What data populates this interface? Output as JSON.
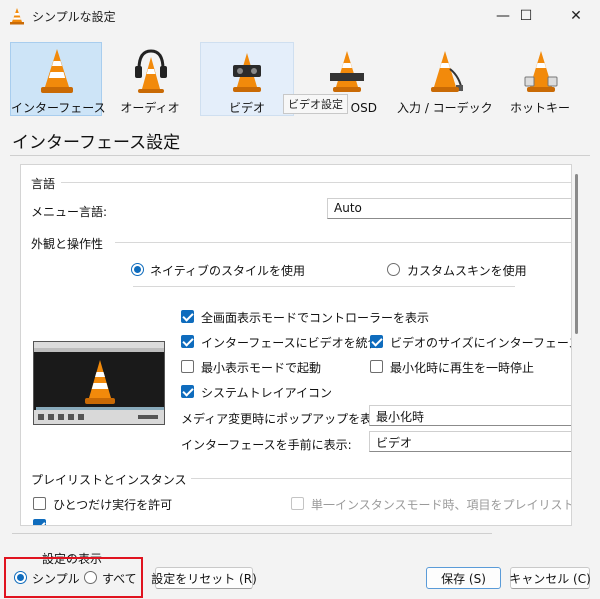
{
  "window": {
    "title": "シンプルな設定",
    "controls": {
      "minimize": "—",
      "maximize": "☐",
      "close": "✕"
    }
  },
  "categories": [
    {
      "label": "インターフェース",
      "icon": "vlc-cone-icon",
      "state": "selected"
    },
    {
      "label": "オーディオ",
      "icon": "headphones-icon",
      "state": "normal"
    },
    {
      "label": "ビデオ",
      "icon": "video-cone-icon",
      "state": "hover"
    },
    {
      "label": "字幕 / OSD",
      "icon": "subtitle-cone-icon",
      "state": "normal"
    },
    {
      "label": "入力 / コーデック",
      "icon": "codec-cone-icon",
      "state": "normal"
    },
    {
      "label": "ホットキー",
      "icon": "hotkey-cone-icon",
      "state": "normal"
    }
  ],
  "tooltip": "ビデオ設定",
  "section_title": "インターフェース設定",
  "language": {
    "group_title": "言語",
    "menu_language_label": "メニュー言語:",
    "menu_language_value": "Auto"
  },
  "look_feel": {
    "group_title": "外観と操作性",
    "native_style_label": "ネイティブのスタイルを使用",
    "native_style_selected": true,
    "custom_skin_label": "カスタムスキンを使用",
    "custom_skin_selected": false,
    "options": {
      "fullscreen_controller": {
        "label": "全画面表示モードでコントローラーを表示",
        "checked": true
      },
      "embed_video": {
        "label": "インターフェースにビデオを統合",
        "checked": true
      },
      "resize_to_video": {
        "label": "ビデオのサイズにインターフェースをリサイズ",
        "checked": true
      },
      "start_minimal": {
        "label": "最小表示モードで起動",
        "checked": false
      },
      "pause_minimized": {
        "label": "最小化時に再生を一時停止",
        "checked": false
      },
      "systray_icon": {
        "label": "システムトレイアイコン",
        "checked": true
      }
    },
    "popup_label": "メディア変更時にポップアップを表示:",
    "popup_value": "最小化時",
    "raise_label": "インターフェースを手前に表示:",
    "raise_value": "ビデオ"
  },
  "playlist": {
    "group_title": "プレイリストとインスタンス",
    "one_instance": {
      "label": "ひとつだけ実行を許可",
      "checked": false
    },
    "enqueue": {
      "label": "単一インスタンスモード時、項目をプレイリストのキューに追加",
      "checked": false
    }
  },
  "show_settings": {
    "label": "設定の表示",
    "simple_label": "シンプル",
    "simple_selected": true,
    "all_label": "すべて",
    "all_selected": false
  },
  "buttons": {
    "reset": "設定をリセット (R)",
    "save": "保存 (S)",
    "cancel": "キャンセル (C)"
  },
  "colors": {
    "accent": "#0f6cbd",
    "selected_category": "#cde4f7",
    "highlight_box": "#e0131f"
  }
}
